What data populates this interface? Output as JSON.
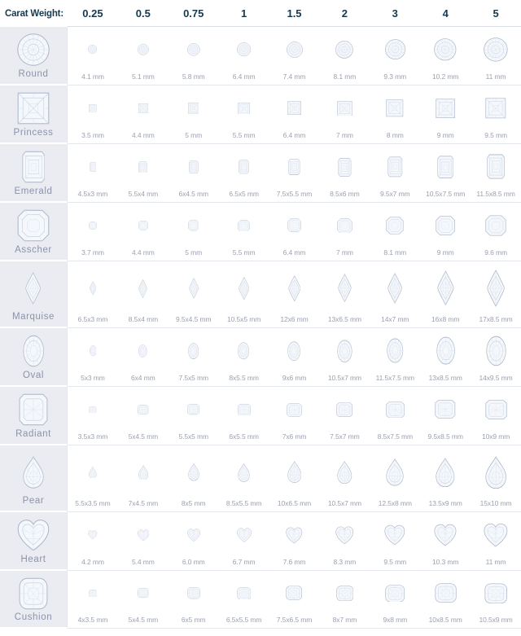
{
  "header": {
    "label": "Carat Weight:",
    "carats": [
      "0.25",
      "0.5",
      "0.75",
      "1",
      "1.5",
      "2",
      "3",
      "4",
      "5"
    ]
  },
  "colors": {
    "header_text": "#16394f",
    "sidebar_bg": "#eaecf2",
    "sidebar_text": "#8b93a8",
    "size_text": "#9aa1b0",
    "gem_outline": "#a9b4c6",
    "gem_fill": "#f4f7fb",
    "row_divider": "#e4e7ed",
    "page_bg": "#ffffff"
  },
  "rows": [
    {
      "shape": "Round",
      "icon": "round-diamond-icon",
      "sizes": [
        "4.1 mm",
        "5.1 mm",
        "5.8 mm",
        "6.4 mm",
        "7.4 mm",
        "8.1 mm",
        "9.3 mm",
        "10.2 mm",
        "11 mm"
      ],
      "mm": [
        4.1,
        5.1,
        5.8,
        6.4,
        7.4,
        8.1,
        9.3,
        10.2,
        11.0
      ],
      "ratio": 1.0
    },
    {
      "shape": "Princess",
      "icon": "princess-diamond-icon",
      "sizes": [
        "3.5 mm",
        "4.4 mm",
        "5 mm",
        "5.5 mm",
        "6.4 mm",
        "7 mm",
        "8 mm",
        "9 mm",
        "9.5 mm"
      ],
      "mm": [
        3.5,
        4.4,
        5.0,
        5.5,
        6.4,
        7.0,
        8.0,
        9.0,
        9.5
      ],
      "ratio": 1.0
    },
    {
      "shape": "Emerald",
      "icon": "emerald-diamond-icon",
      "sizes": [
        "4.5x3 mm",
        "5.5x4 mm",
        "6x4.5 mm",
        "6.5x5 mm",
        "7.5x5.5 mm",
        "8.5x6 mm",
        "9.5x7 mm",
        "10.5x7.5 mm",
        "11.5x8.5 mm"
      ],
      "mm": [
        4.5,
        5.5,
        6.0,
        6.5,
        7.5,
        8.5,
        9.5,
        10.5,
        11.5
      ],
      "ratio": 0.72
    },
    {
      "shape": "Asscher",
      "icon": "asscher-diamond-icon",
      "sizes": [
        "3.7 mm",
        "4.4 mm",
        "5 mm",
        "5.5 mm",
        "6.4 mm",
        "7 mm",
        "8.1 mm",
        "9 mm",
        "9.6 mm"
      ],
      "mm": [
        3.7,
        4.4,
        5.0,
        5.5,
        6.4,
        7.0,
        8.1,
        9.0,
        9.6
      ],
      "ratio": 1.0
    },
    {
      "shape": "Marquise",
      "icon": "marquise-diamond-icon",
      "sizes": [
        "6.5x3 mm",
        "8.5x4 mm",
        "9.5x4.5 mm",
        "10.5x5 mm",
        "12x6 mm",
        "13x6.5 mm",
        "14x7 mm",
        "16x8 mm",
        "17x8.5 mm"
      ],
      "mm": [
        6.5,
        8.5,
        9.5,
        10.5,
        12.0,
        13.0,
        14.0,
        16.0,
        17.0
      ],
      "ratio": 0.48
    },
    {
      "shape": "Oval",
      "icon": "oval-diamond-icon",
      "sizes": [
        "5x3 mm",
        "6x4 mm",
        "7.5x5 mm",
        "8x5.5 mm",
        "9x6 mm",
        "10.5x7 mm",
        "11.5x7.5 mm",
        "13x8.5 mm",
        "14x9.5 mm"
      ],
      "mm": [
        5.0,
        6.0,
        7.5,
        8.0,
        9.0,
        10.5,
        11.5,
        13.0,
        14.0
      ],
      "ratio": 0.66
    },
    {
      "shape": "Radiant",
      "icon": "radiant-diamond-icon",
      "sizes": [
        "3.5x3 mm",
        "5x4.5 mm",
        "5.5x5 mm",
        "6x5.5 mm",
        "7x6 mm",
        "7.5x7 mm",
        "8.5x7.5 mm",
        "9.5x8.5 mm",
        "10x9 mm"
      ],
      "mm": [
        3.5,
        5.0,
        5.5,
        6.0,
        7.0,
        7.5,
        8.5,
        9.5,
        10.0
      ],
      "ratio": 0.9
    },
    {
      "shape": "Pear",
      "icon": "pear-diamond-icon",
      "sizes": [
        "5.5x3.5 mm",
        "7x4.5 mm",
        "8x5 mm",
        "8.5x5.5 mm",
        "10x6.5 mm",
        "10.5x7 mm",
        "12.5x8 mm",
        "13.5x9 mm",
        "15x10 mm"
      ],
      "mm": [
        5.5,
        7.0,
        8.0,
        8.5,
        10.0,
        10.5,
        12.5,
        13.5,
        15.0
      ],
      "ratio": 0.65
    },
    {
      "shape": "Heart",
      "icon": "heart-diamond-icon",
      "sizes": [
        "4.2 mm",
        "5.4 mm",
        "6.0 mm",
        "6.7 mm",
        "7.6 mm",
        "8.3 mm",
        "9.5 mm",
        "10.3 mm",
        "11 mm"
      ],
      "mm": [
        4.2,
        5.4,
        6.0,
        6.7,
        7.6,
        8.3,
        9.5,
        10.3,
        11.0
      ],
      "ratio": 1.0
    },
    {
      "shape": "Cushion",
      "icon": "cushion-diamond-icon",
      "sizes": [
        "4x3.5 mm",
        "5x4.5 mm",
        "6x5 mm",
        "6.5x5.5 mm",
        "7.5x6.5 mm",
        "8x7 mm",
        "9x8 mm",
        "10x8.5 mm",
        "10.5x9 mm"
      ],
      "mm": [
        4.0,
        5.0,
        6.0,
        6.5,
        7.5,
        8.0,
        9.0,
        10.0,
        10.5
      ],
      "ratio": 0.9
    }
  ]
}
